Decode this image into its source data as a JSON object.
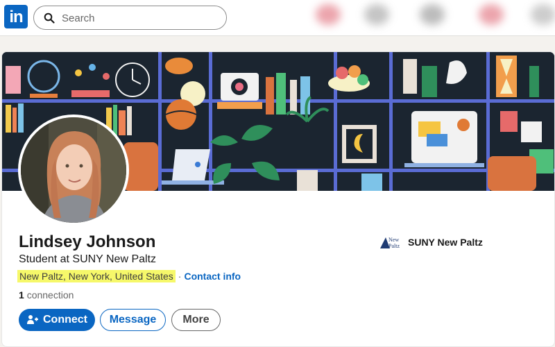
{
  "nav": {
    "logo_text": "in",
    "search_placeholder": "Search"
  },
  "profile": {
    "name": "Lindsey Johnson",
    "headline": "Student at SUNY New Paltz",
    "location": "New Paltz, New York, United States",
    "separator": "·",
    "contact_info": "Contact info",
    "connections_count": "1",
    "connections_label": "connection"
  },
  "organization": {
    "name": "SUNY New Paltz",
    "logo_text_line1": "New",
    "logo_text_line2": "Paltz"
  },
  "actions": {
    "connect_label": "Connect",
    "message_label": "Message",
    "more_label": "More"
  },
  "colors": {
    "brand": "#0a66c2",
    "highlight": "#f6f86a",
    "banner_bg": "#1b2530"
  }
}
